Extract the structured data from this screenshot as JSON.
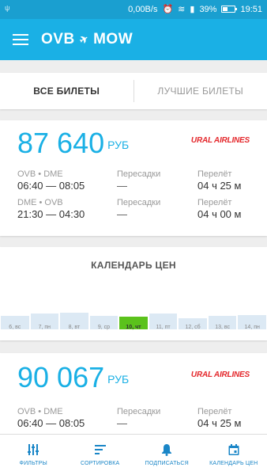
{
  "statusbar": {
    "speed": "0,00B/s",
    "battery": "39%",
    "time": "19:51"
  },
  "appbar": {
    "origin": "OVB",
    "destination": "MOW"
  },
  "tabs": [
    {
      "label": "ВСЕ БИЛЕТЫ",
      "active": true
    },
    {
      "label": "ЛУЧШИЕ БИЛЕТЫ",
      "active": false
    }
  ],
  "tickets": [
    {
      "price": "87 640",
      "currency": "РУБ",
      "airline": "URAL AIRLINES",
      "segments": [
        {
          "route": "OVB • DME",
          "times": "06:40 — 08:05",
          "transfers_label": "Пересадки",
          "transfers": "—",
          "duration_label": "Перелёт",
          "duration": "04 ч 25 м"
        },
        {
          "route": "DME • OVB",
          "times": "21:30 — 04:30",
          "transfers_label": "Пересадки",
          "transfers": "—",
          "duration_label": "Перелёт",
          "duration": "04 ч 00 м"
        }
      ]
    },
    {
      "price": "90 067",
      "currency": "РУБ",
      "airline": "URAL AIRLINES",
      "segments": [
        {
          "route": "OVB • DME",
          "times": "06:40 — 08:05",
          "transfers_label": "Пересадки",
          "transfers": "—",
          "duration_label": "Перелёт",
          "duration": "04 ч 25 м"
        }
      ]
    }
  ],
  "calendar": {
    "title": "КАЛЕНДАРЬ ЦЕН",
    "days": [
      {
        "label": "6, вс",
        "level": 0.65,
        "selected": false
      },
      {
        "label": "7, пн",
        "level": 0.75,
        "selected": false
      },
      {
        "label": "8, вт",
        "level": 0.8,
        "selected": false
      },
      {
        "label": "9, ср",
        "level": 0.65,
        "selected": false
      },
      {
        "label": "10, чт",
        "level": 0.6,
        "selected": true
      },
      {
        "label": "11, пт",
        "level": 0.75,
        "selected": false
      },
      {
        "label": "12, сб",
        "level": 0.55,
        "selected": false
      },
      {
        "label": "13, вс",
        "level": 0.65,
        "selected": false
      },
      {
        "label": "14, пн",
        "level": 0.7,
        "selected": false
      }
    ],
    "colors": {
      "bar": "#dce9f4",
      "selected": "#5bc21c"
    }
  },
  "bottomnav": [
    {
      "label": "ФИЛЬТРЫ",
      "icon": "filter-icon"
    },
    {
      "label": "СОРТИРОВКА",
      "icon": "sort-icon"
    },
    {
      "label": "ПОДПИСАТЬСЯ",
      "icon": "bell-icon"
    },
    {
      "label": "КАЛЕНДАРЬ ЦЕН",
      "icon": "calendar-icon"
    }
  ],
  "colors": {
    "primary": "#1ab0e5",
    "airline": "#e4282c",
    "nav": "#1a86c7"
  }
}
